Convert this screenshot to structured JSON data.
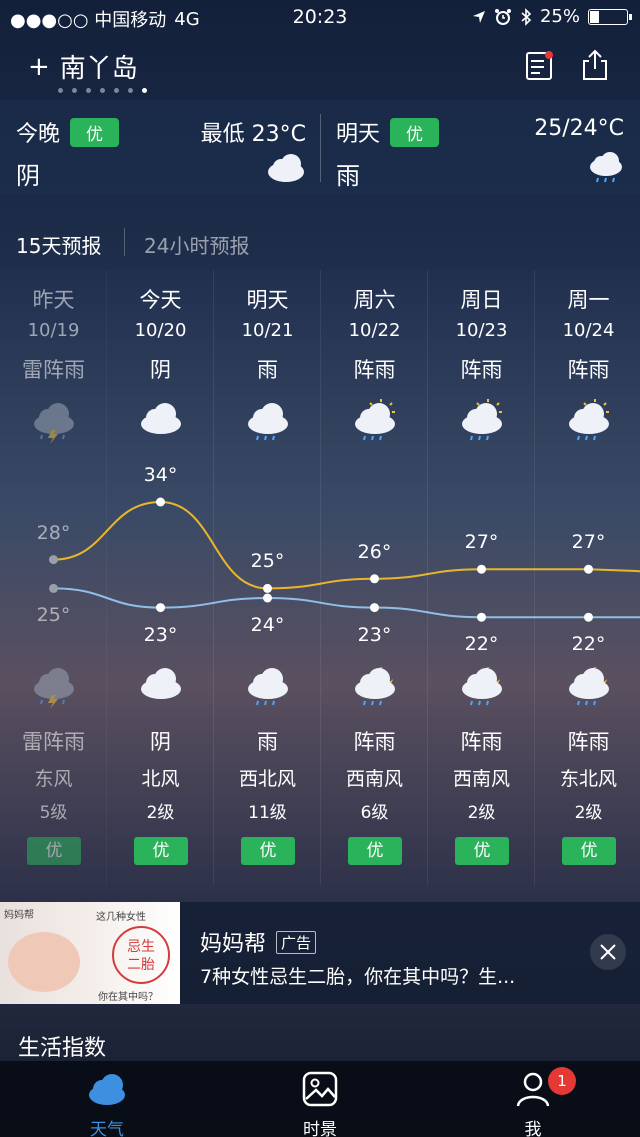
{
  "status_bar": {
    "carrier": "●●●○○ 中国移动",
    "network": "4G",
    "time": "20:23",
    "battery": "25%",
    "battery_level": 0.25
  },
  "header": {
    "add_symbol": "+",
    "city": "南丫岛",
    "page_count": 7,
    "active_page": 6
  },
  "summary": {
    "tonight": {
      "label": "今晚",
      "aqi": "优",
      "temp": "最低 23°C",
      "weather": "阴",
      "icon": "cloud-icon"
    },
    "tomorrow": {
      "label": "明天",
      "aqi": "优",
      "temp": "25/24°C",
      "weather": "雨",
      "icon": "rain-icon"
    }
  },
  "tabs": {
    "forecast15": "15天预报",
    "forecast24": "24小时预报"
  },
  "forecast": [
    {
      "day": "昨天",
      "date": "10/19",
      "day_weather": "雷阵雨",
      "day_icon": "thunderstorm-icon",
      "high": "28°",
      "low": "25°",
      "night_icon": "thunderstorm-icon",
      "night_weather": "雷阵雨",
      "wind_dir": "东风",
      "wind_level": "5级",
      "aqi": "优",
      "past": true
    },
    {
      "day": "今天",
      "date": "10/20",
      "day_weather": "阴",
      "day_icon": "cloud-icon",
      "high": "34°",
      "low": "23°",
      "night_icon": "cloud-icon",
      "night_weather": "阴",
      "wind_dir": "北风",
      "wind_level": "2级",
      "aqi": "优",
      "past": false
    },
    {
      "day": "明天",
      "date": "10/21",
      "day_weather": "雨",
      "day_icon": "rain-icon",
      "high": "25°",
      "low": "24°",
      "night_icon": "rain-icon",
      "night_weather": "雨",
      "wind_dir": "西北风",
      "wind_level": "11级",
      "aqi": "优",
      "past": false
    },
    {
      "day": "周六",
      "date": "10/22",
      "day_weather": "阵雨",
      "day_icon": "sun-shower-icon",
      "high": "26°",
      "low": "23°",
      "night_icon": "moon-shower-icon",
      "night_weather": "阵雨",
      "wind_dir": "西南风",
      "wind_level": "6级",
      "aqi": "优",
      "past": false
    },
    {
      "day": "周日",
      "date": "10/23",
      "day_weather": "阵雨",
      "day_icon": "sun-shower-icon",
      "high": "27°",
      "low": "22°",
      "night_icon": "moon-shower-icon",
      "night_weather": "阵雨",
      "wind_dir": "西南风",
      "wind_level": "2级",
      "aqi": "优",
      "past": false
    },
    {
      "day": "周一",
      "date": "10/24",
      "day_weather": "阵雨",
      "day_icon": "sun-shower-icon",
      "high": "27°",
      "low": "22°",
      "night_icon": "moon-shower-icon",
      "night_weather": "阵雨",
      "wind_dir": "东北风",
      "wind_level": "2级",
      "aqi": "优",
      "past": false
    }
  ],
  "chart_data": {
    "type": "line",
    "categories": [
      "10/19",
      "10/20",
      "10/21",
      "10/22",
      "10/23",
      "10/24"
    ],
    "series": [
      {
        "values": [
          28,
          34,
          25,
          26,
          27,
          27
        ]
      },
      {
        "values": [
          25,
          23,
          24,
          23,
          22,
          22
        ]
      }
    ],
    "colors": [
      "#e8b62c",
      "#8fbfe6"
    ]
  },
  "ad": {
    "title": "妈妈帮",
    "tag": "广告",
    "desc": "7种女性忌生二胎，你在其中吗？生...",
    "img_text_top": "这几种女性",
    "img_text_circle1": "忌生",
    "img_text_circle2": "二胎",
    "img_text_bottom": "你在其中吗？",
    "img_logo": "妈妈帮"
  },
  "life_index": "生活指数",
  "bottom_nav": {
    "weather": "天气",
    "scenery": "时景",
    "me": "我",
    "badge": "1"
  },
  "colors": {
    "aqi_good": "#2ab35a",
    "badge_red": "#e53935",
    "nav_active": "#3d8fe0"
  }
}
